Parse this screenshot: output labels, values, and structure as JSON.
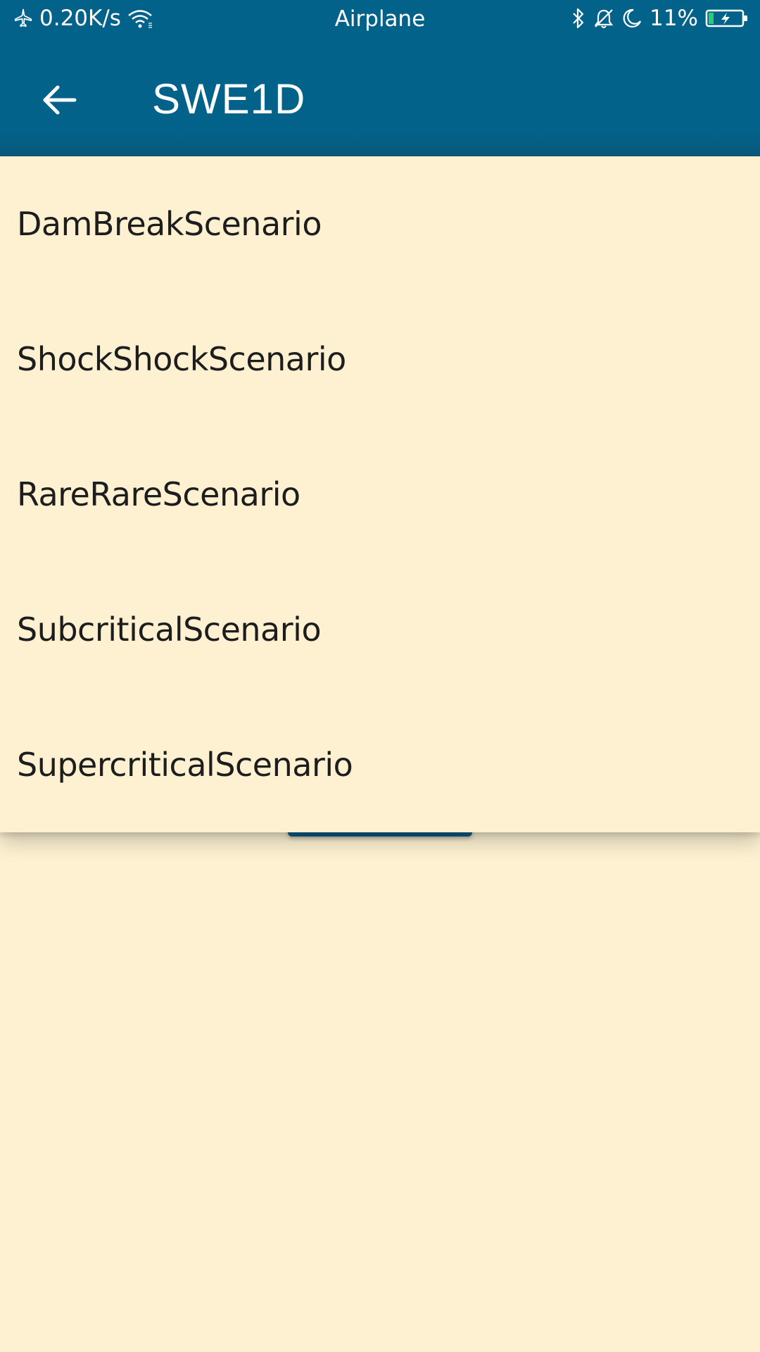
{
  "status_bar": {
    "network_speed": "0.20K/s",
    "mode": "Airplane",
    "battery": "11%",
    "icons": [
      "airplane-icon",
      "wifi-icon",
      "bluetooth-icon",
      "bell-off-icon",
      "moon-icon",
      "battery-charging-icon"
    ]
  },
  "app_bar": {
    "title": "SWE1D",
    "back_icon": "arrow-left-icon",
    "background_color": "#02628a"
  },
  "dropdown": {
    "items": [
      {
        "label": "DamBreakScenario"
      },
      {
        "label": "ShockShockScenario"
      },
      {
        "label": "RareRareScenario"
      },
      {
        "label": "SubcriticalScenario"
      },
      {
        "label": "SupercriticalScenario"
      }
    ]
  },
  "colors": {
    "background": "#fdf1d2",
    "accent": "#02628a",
    "text": "#1d1d1d"
  }
}
